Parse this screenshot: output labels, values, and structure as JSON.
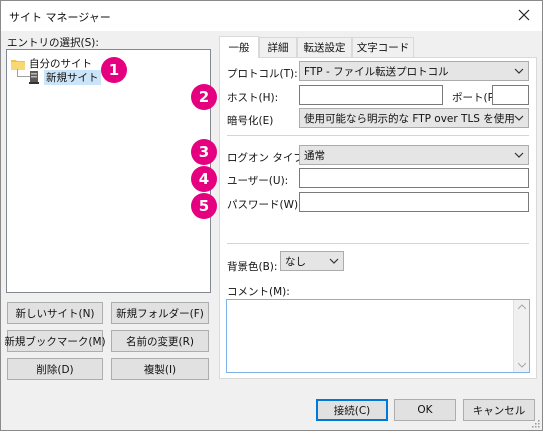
{
  "window": {
    "title": "サイト マネージャー"
  },
  "tree": {
    "label": "エントリの選択(S):",
    "root": "自分のサイト",
    "child": "新規サイト"
  },
  "left_buttons": {
    "new_site": "新しいサイト(N)",
    "new_folder": "新規フォルダー(F)",
    "new_bookmark": "新規ブックマーク(M)",
    "rename": "名前の変更(R)",
    "delete": "削除(D)",
    "duplicate": "複製(I)"
  },
  "tabs": [
    "一般",
    "詳細",
    "転送設定",
    "文字コード"
  ],
  "general": {
    "protocol_label": "プロトコル(T):",
    "protocol_value": "FTP - ファイル転送プロトコル",
    "host_label": "ホスト(H):",
    "host_value": "",
    "port_label": "ポート(P):",
    "port_value": "",
    "encryption_label": "暗号化(E)",
    "encryption_value": "使用可能なら明示的な FTP over TLS を使用",
    "logon_label": "ログオン タイプ(L):",
    "logon_value": "通常",
    "user_label": "ユーザー(U):",
    "user_value": "",
    "password_label": "パスワード(W):",
    "password_value": "",
    "bgcolor_label": "背景色(B):",
    "bgcolor_value": "なし",
    "comment_label": "コメント(M):",
    "comment_value": ""
  },
  "badges": [
    "1",
    "2",
    "3",
    "4",
    "5"
  ],
  "footer": {
    "connect": "接続(C)",
    "ok": "OK",
    "cancel": "キャンセル"
  },
  "colors": {
    "badge": "#e4007f",
    "accent": "#0078d7"
  }
}
